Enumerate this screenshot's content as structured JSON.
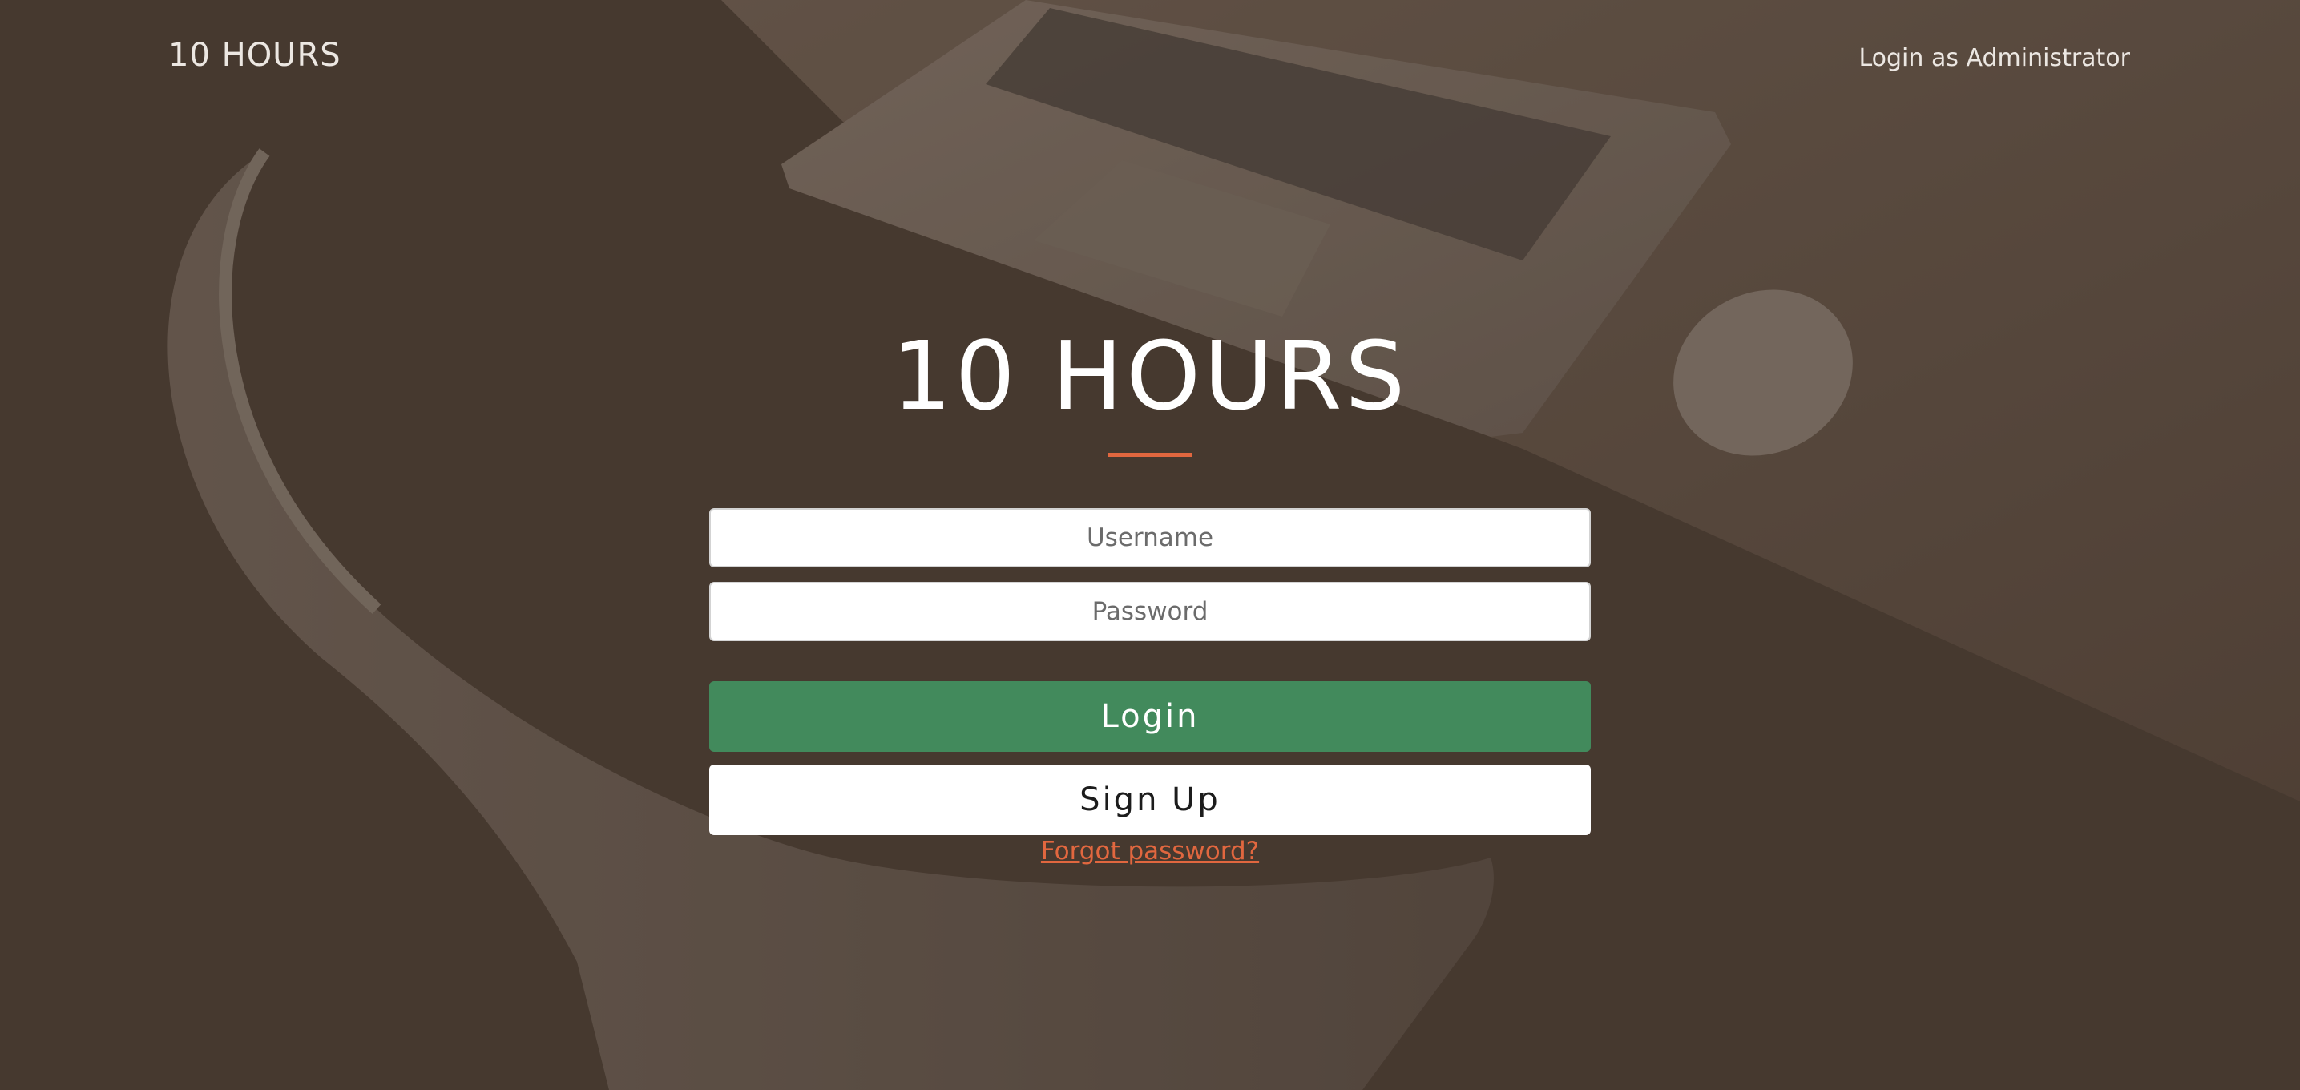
{
  "nav": {
    "brand": "10 HOURS",
    "admin_link": "Login as Administrator"
  },
  "hero": {
    "title": "10 HOURS"
  },
  "form": {
    "username_placeholder": "Username",
    "password_placeholder": "Password",
    "login_label": "Login",
    "signup_label": "Sign Up",
    "forgot_label": "Forgot password?"
  },
  "colors": {
    "accent": "#e1673f",
    "login_button": "#428a5c",
    "overlay": "#4d4036"
  }
}
